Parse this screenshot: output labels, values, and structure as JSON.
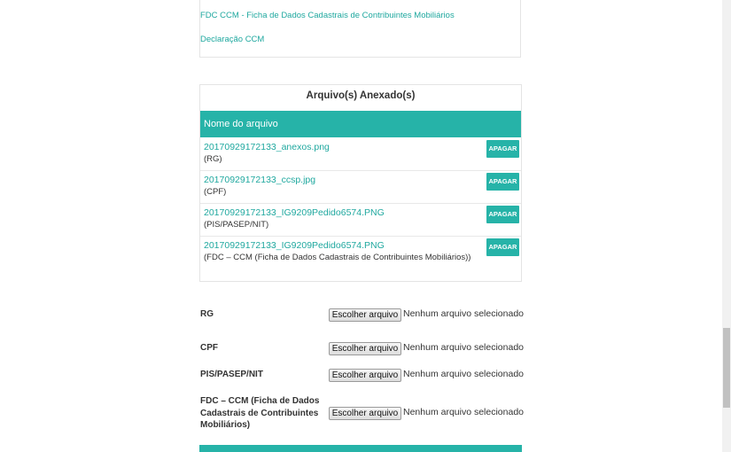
{
  "documents": {
    "links": [
      "FDC CCM - Ficha de Dados Cadastrais de Contribuintes Mobiliários",
      "Declaração CCM"
    ]
  },
  "attachments": {
    "title": "Arquivo(s) Anexado(s)",
    "column_header": "Nome do arquivo",
    "delete_label": "APAGAR",
    "files": [
      {
        "name": "20170929172133_anexos.png",
        "type": "(RG)"
      },
      {
        "name": "20170929172133_ccsp.jpg",
        "type": "(CPF)"
      },
      {
        "name": "20170929172133_IG9209Pedido6574.PNG",
        "type": "(PIS/PASEP/NIT)"
      },
      {
        "name": "20170929172133_IG9209Pedido6574.PNG",
        "type": "(FDC – CCM (Ficha de Dados Cadastrais de Contribuintes Mobiliários))"
      }
    ]
  },
  "uploads": {
    "button_label": "Escolher arquivo",
    "status_text": "Nenhum arquivo selecionado",
    "fields": [
      {
        "label": "RG"
      },
      {
        "label": "CPF"
      },
      {
        "label": "PIS/PASEP/NIT"
      },
      {
        "label": "FDC – CCM (Ficha de Dados Cadastrais de Contribuintes Mobiliários)"
      }
    ]
  },
  "colors": {
    "accent": "#26b3a8",
    "link": "#1fa89f"
  }
}
